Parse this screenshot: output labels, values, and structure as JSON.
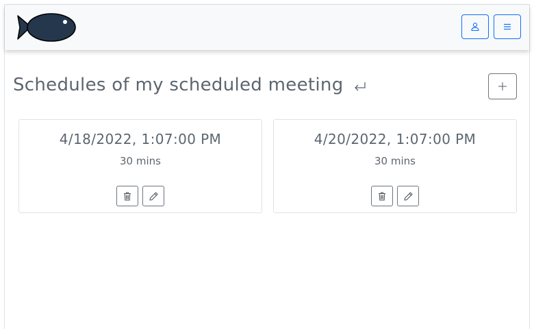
{
  "header": {
    "logo_icon": "fish-logo-icon",
    "user_button_icon": "person-icon",
    "menu_button_icon": "hamburger-menu-icon",
    "accent_color": "#0d6efd"
  },
  "main": {
    "title": "Schedules of my scheduled meeting",
    "back_icon": "return-arrow-icon",
    "add_icon": "plus-icon"
  },
  "schedules": [
    {
      "date": "4/18/2022, 1:07:00 PM",
      "duration": "30 mins",
      "delete_icon": "trash-icon",
      "edit_icon": "pencil-icon"
    },
    {
      "date": "4/20/2022, 1:07:00 PM",
      "duration": "30 mins",
      "delete_icon": "trash-icon",
      "edit_icon": "pencil-icon"
    }
  ]
}
